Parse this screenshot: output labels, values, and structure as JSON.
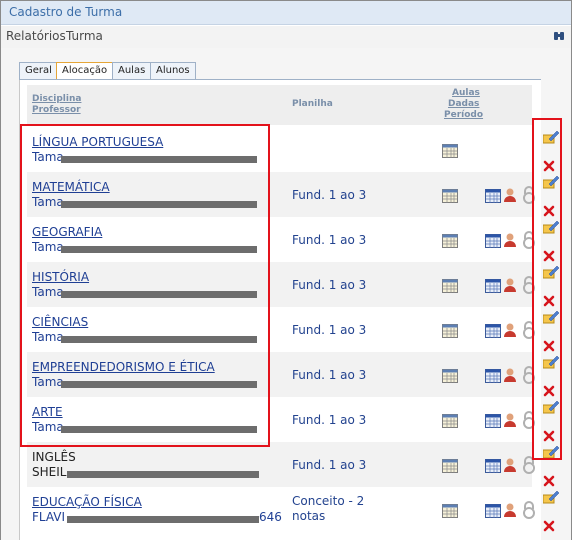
{
  "window": {
    "title": "Cadastro de Turma"
  },
  "menu": {
    "items": [
      "Relatórios",
      "Turma"
    ]
  },
  "tabs": [
    "Geral",
    "Alocação",
    "Aulas",
    "Alunos"
  ],
  "table": {
    "headers": {
      "discipline": "Disciplina",
      "teacher": "Professor",
      "plan": "Planilha",
      "lessons_1": "Aulas",
      "lessons_2": "Dadas",
      "lessons_3": "Período"
    },
    "rows": [
      {
        "discipline": "LÍNGUA PORTUGUESA",
        "teacher": "Tama",
        "plan": ""
      },
      {
        "discipline": "MATEMÁTICA",
        "teacher": "Tama",
        "plan": "Fund. 1 ao 3"
      },
      {
        "discipline": "GEOGRAFIA",
        "teacher": "Tama",
        "plan": "Fund. 1 ao 3"
      },
      {
        "discipline": "HISTÓRIA",
        "teacher": "Tama",
        "plan": "Fund. 1 ao 3"
      },
      {
        "discipline": "CIÊNCIAS",
        "teacher": "Tama",
        "plan": "Fund. 1 ao 3"
      },
      {
        "discipline": "EMPREENDEDORISMO E ÉTICA",
        "teacher": "Tama",
        "plan": "Fund. 1 ao 3"
      },
      {
        "discipline": "ARTE",
        "teacher": "Tama",
        "plan": "Fund. 1 ao 3"
      },
      {
        "discipline": "INGLÊS",
        "teacher": "SHEIL",
        "plan": "Fund. 1 ao 3"
      },
      {
        "discipline": "EDUCAÇÃO FÍSICA",
        "teacher": "FLAVI",
        "teacher_suffix": "646",
        "plan": "Conceito - 2 notas"
      }
    ]
  },
  "colors": {
    "highlight": "#e3121b",
    "link": "#1f3f94",
    "header_text": "#7a8fa9"
  },
  "icons": [
    "lessons-grid-icon",
    "calendar-grid-icon",
    "teacher-user-icon",
    "lock-icon",
    "edit-pencil-icon",
    "delete-x-icon",
    "binoculars-icon"
  ]
}
